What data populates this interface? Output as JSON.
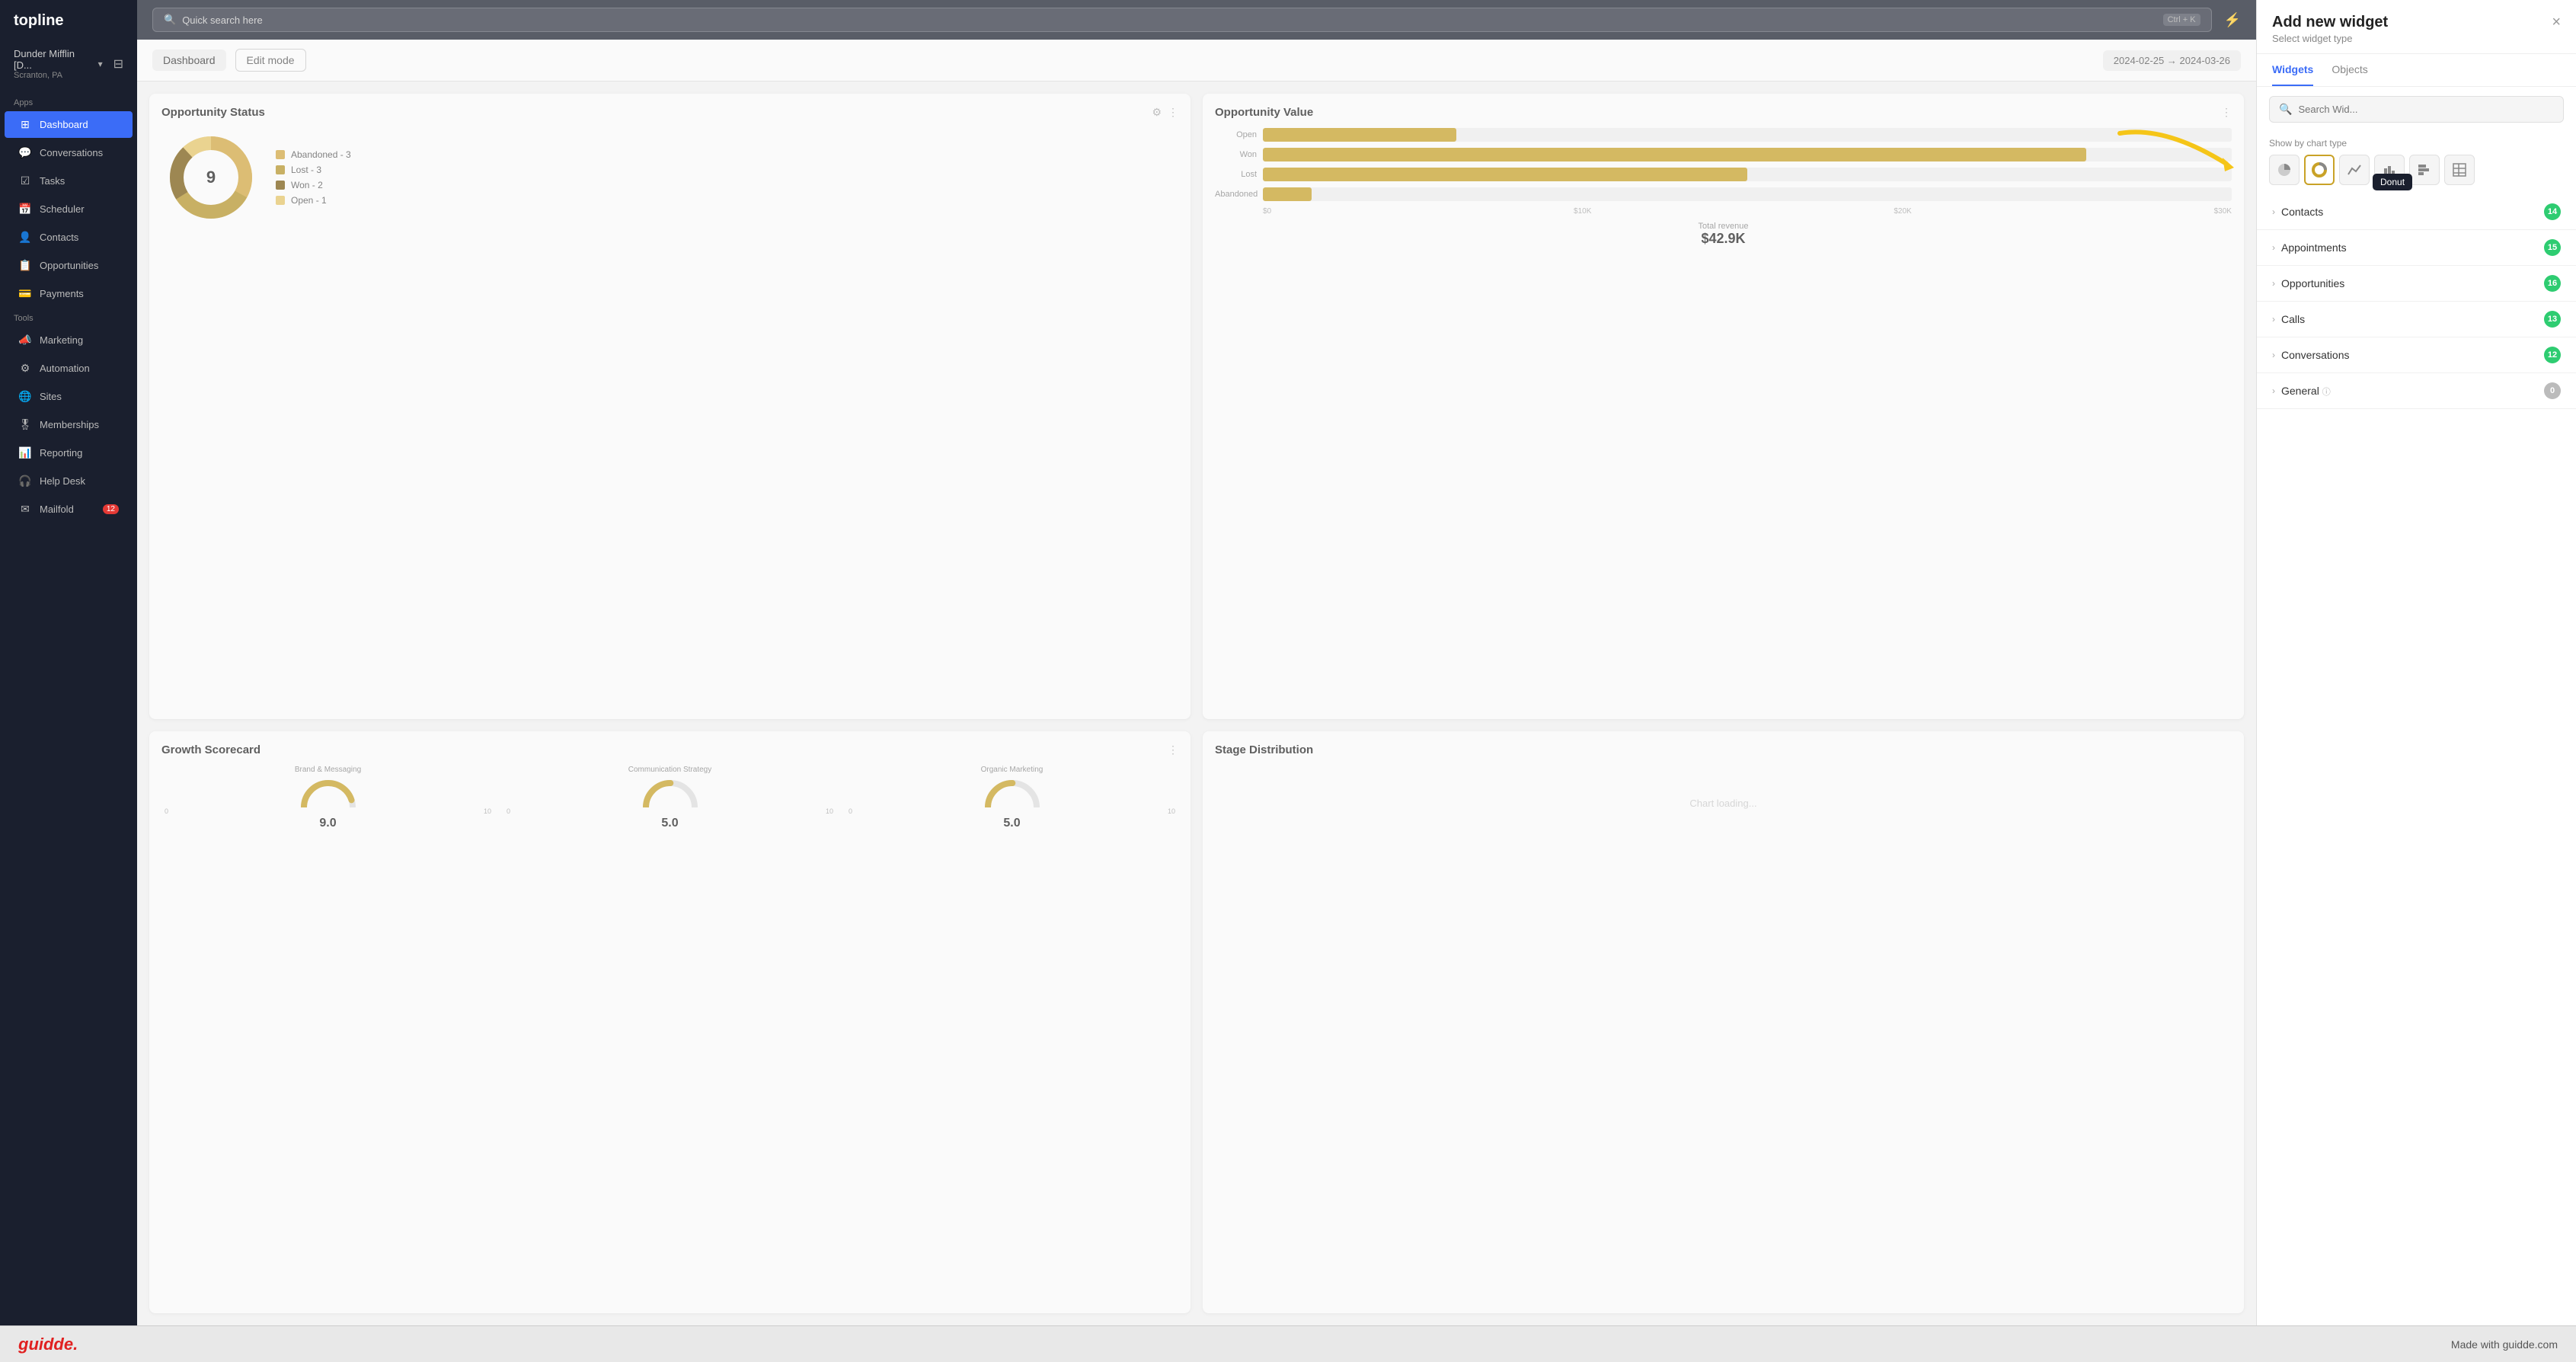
{
  "app": {
    "brand": "topline",
    "search_placeholder": "Quick search here",
    "search_shortcut": "Ctrl + K",
    "lightning_icon": "⚡"
  },
  "sidebar": {
    "account_name": "Dunder Mifflin [D...",
    "account_sub": "Scranton, PA",
    "sections": [
      {
        "label": "Apps",
        "items": [
          {
            "id": "dashboard",
            "label": "Dashboard",
            "icon": "⊞",
            "active": true
          },
          {
            "id": "conversations",
            "label": "Conversations",
            "icon": "💬"
          },
          {
            "id": "tasks",
            "label": "Tasks",
            "icon": "☑"
          },
          {
            "id": "scheduler",
            "label": "Scheduler",
            "icon": "📅"
          },
          {
            "id": "contacts",
            "label": "Contacts",
            "icon": "👤"
          },
          {
            "id": "opportunities",
            "label": "Opportunities",
            "icon": "📋"
          },
          {
            "id": "payments",
            "label": "Payments",
            "icon": "💳"
          }
        ]
      },
      {
        "label": "Tools",
        "items": [
          {
            "id": "marketing",
            "label": "Marketing",
            "icon": "📣"
          },
          {
            "id": "automation",
            "label": "Automation",
            "icon": "⚙"
          },
          {
            "id": "sites",
            "label": "Sites",
            "icon": "🌐"
          },
          {
            "id": "memberships",
            "label": "Memberships",
            "icon": "🎖"
          },
          {
            "id": "reporting",
            "label": "Reporting",
            "icon": "📊"
          },
          {
            "id": "helpdesk",
            "label": "Help Desk",
            "icon": "🎧"
          },
          {
            "id": "mailfold",
            "label": "Mailfold",
            "icon": "✉",
            "badge": "12"
          }
        ]
      }
    ]
  },
  "topbar": {
    "search_text": "Quick search here"
  },
  "dashboard_bar": {
    "title": "Dashboard",
    "edit_mode": "Edit mode",
    "date_from": "2024-02-25",
    "date_to": "2024-03-26",
    "date_arrow": "→"
  },
  "widgets": {
    "opportunity_status": {
      "title": "Opportunity Status",
      "center_value": "9",
      "legend": [
        {
          "label": "Abandoned - 3",
          "color": "#d4a840"
        },
        {
          "label": "Lost - 3",
          "color": "#b8952a"
        },
        {
          "label": "Won - 2",
          "color": "#8b6914"
        },
        {
          "label": "Open - 1",
          "color": "#e8c868"
        }
      ],
      "donut_segments": [
        {
          "label": "Abandoned",
          "value": 3,
          "color": "#d4a840",
          "pct": 33
        },
        {
          "label": "Lost",
          "value": 3,
          "color": "#b8952a",
          "pct": 33
        },
        {
          "label": "Won",
          "value": 2,
          "color": "#7a5c10",
          "pct": 22
        },
        {
          "label": "Open",
          "value": 1,
          "color": "#e8c868",
          "pct": 11
        }
      ]
    },
    "opportunity_value": {
      "title": "Opportunity Value",
      "bars": [
        {
          "label": "Open",
          "pct": 20
        },
        {
          "label": "Won",
          "pct": 85
        },
        {
          "label": "Lost",
          "pct": 50
        },
        {
          "label": "Abandoned",
          "pct": 5
        }
      ],
      "x_labels": [
        "$0",
        "$10K",
        "$20K",
        "$30K"
      ],
      "revenue_label": "Total revenue",
      "revenue_value": "$42.9K"
    },
    "growth_scorecard": {
      "title": "Growth Scorecard",
      "gauges": [
        {
          "label": "Brand & Messaging",
          "value": "9.0",
          "pct": 90
        },
        {
          "label": "Communication Strategy",
          "value": "5.0",
          "pct": 50
        },
        {
          "label": "Organic Marketing",
          "value": "5.0",
          "pct": 50
        }
      ]
    },
    "stage_distribution": {
      "title": "Stage Distribution"
    }
  },
  "right_panel": {
    "title": "Add new widget",
    "subtitle": "Select widget type",
    "close_icon": "×",
    "tabs": [
      {
        "id": "widgets",
        "label": "Widgets",
        "active": true
      },
      {
        "id": "objects",
        "label": "Objects"
      }
    ],
    "search_placeholder": "Search Wid...",
    "chart_type": {
      "label": "Show by chart type",
      "buttons": [
        {
          "id": "pie",
          "icon": "◔",
          "active": false
        },
        {
          "id": "donut",
          "icon": "⊙",
          "active": true,
          "tooltip": "Donut"
        },
        {
          "id": "line",
          "icon": "📈",
          "active": false
        },
        {
          "id": "bar-v",
          "icon": "📊",
          "active": false
        },
        {
          "id": "bar-h",
          "icon": "≡",
          "active": false
        },
        {
          "id": "table",
          "icon": "⊞",
          "active": false
        }
      ]
    },
    "categories": [
      {
        "id": "contacts",
        "label": "Contacts",
        "count": 14
      },
      {
        "id": "appointments",
        "label": "Appointments",
        "count": 15
      },
      {
        "id": "opportunities",
        "label": "Opportunities",
        "count": 16
      },
      {
        "id": "calls",
        "label": "Calls",
        "count": 13
      },
      {
        "id": "conversations",
        "label": "Conversations",
        "count": 12
      },
      {
        "id": "general",
        "label": "General",
        "count": 0,
        "has_info": true
      }
    ],
    "tooltip_text": "Donut"
  },
  "footer": {
    "logo_text": "guidde.",
    "right_text": "Made with guidde.com"
  }
}
